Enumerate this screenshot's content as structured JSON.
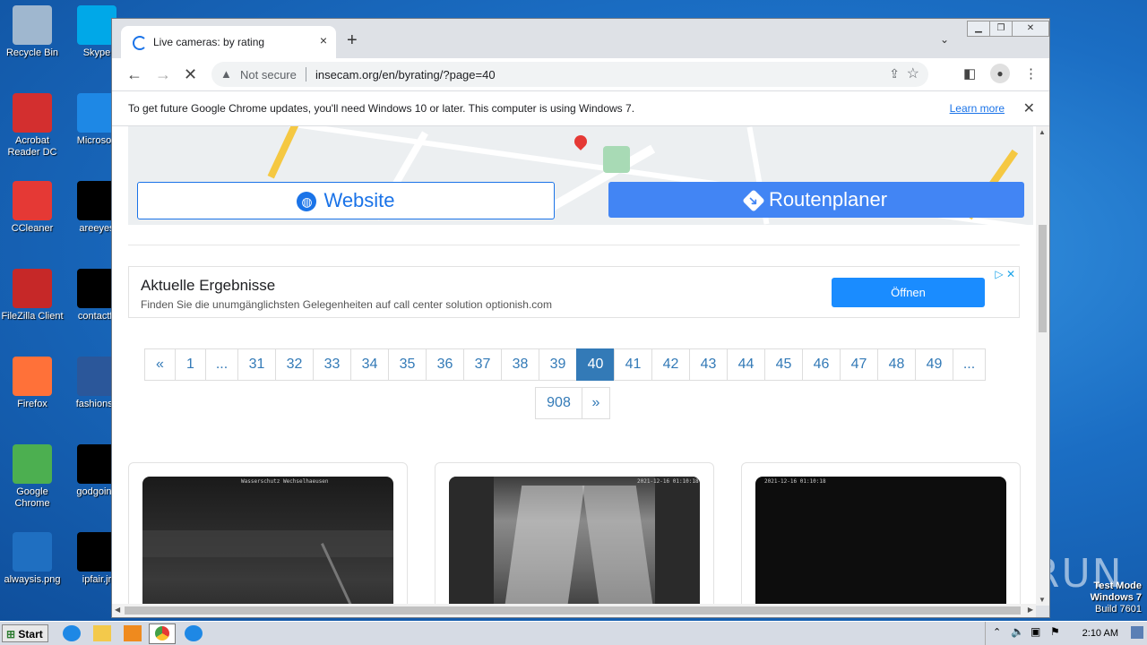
{
  "desktop": {
    "icons": [
      {
        "label": "Recycle Bin",
        "color": "#9fb7cf"
      },
      {
        "label": "Skype",
        "color": "#00a8e8"
      },
      {
        "label": "Acrobat Reader DC",
        "color": "#d32f2f"
      },
      {
        "label": "Microsoft",
        "color": "#1e88e5"
      },
      {
        "label": "CCleaner",
        "color": "#e53935"
      },
      {
        "label": "areeyes",
        "color": "#000000"
      },
      {
        "label": "FileZilla Client",
        "color": "#c62828"
      },
      {
        "label": "contactfr",
        "color": "#000000"
      },
      {
        "label": "Firefox",
        "color": "#ff7139"
      },
      {
        "label": "fashionsy",
        "color": "#2b579a"
      },
      {
        "label": "Google Chrome",
        "color": "#4caf50"
      },
      {
        "label": "godgoing",
        "color": "#000000"
      },
      {
        "label": "alwaysis.png",
        "color": "#1f6fc1"
      },
      {
        "label": "ipfair.jr",
        "color": "#000000"
      }
    ],
    "watermark": {
      "line1": "Test Mode",
      "line2": "Windows 7",
      "line3": "Build 7601"
    },
    "anyrun": "ANY RUN"
  },
  "taskbar": {
    "start_label": "Start",
    "clock": "2:10 AM"
  },
  "browser": {
    "tab_title": "Live cameras: by rating",
    "tab_close": "×",
    "new_tab": "+",
    "tab_search": "⌄",
    "window_buttons": {
      "min": "▁",
      "max": "❐",
      "close": "✕"
    },
    "nav": {
      "back": "←",
      "forward": "→",
      "reload": "✕"
    },
    "omnibox": {
      "warning_icon": "▲",
      "security_text": "Not secure",
      "url": "insecam.org/en/byrating/?page=40"
    },
    "infobar": {
      "message": "To get future Google Chrome updates, you'll need Windows 10 or later. This computer is using Windows 7.",
      "link": "Learn more",
      "close": "✕"
    }
  },
  "page": {
    "map_buttons": {
      "website": "Website",
      "route": "Routenplaner"
    },
    "ad": {
      "headline": "Aktuelle Ergebnisse",
      "text": "Finden Sie die unumgänglichsten Gelegenheiten auf call center solution optionish.com",
      "button": "Öffnen",
      "ad_icons": "▷ ✕"
    },
    "pagination": {
      "row1": [
        "«",
        "1",
        "...",
        "31",
        "32",
        "33",
        "34",
        "35",
        "36",
        "37",
        "38",
        "39",
        "40",
        "41",
        "42",
        "43",
        "44",
        "45",
        "46",
        "47",
        "48",
        "49",
        "..."
      ],
      "row2": [
        "908",
        "»"
      ],
      "active": "40"
    },
    "cameras": [
      {
        "timestamp": "Wasserschutz Wechselhaeusen"
      },
      {
        "timestamp": "2021-12-16 01:10:18"
      },
      {
        "timestamp": "2021-12-16 01:10:18"
      }
    ]
  }
}
